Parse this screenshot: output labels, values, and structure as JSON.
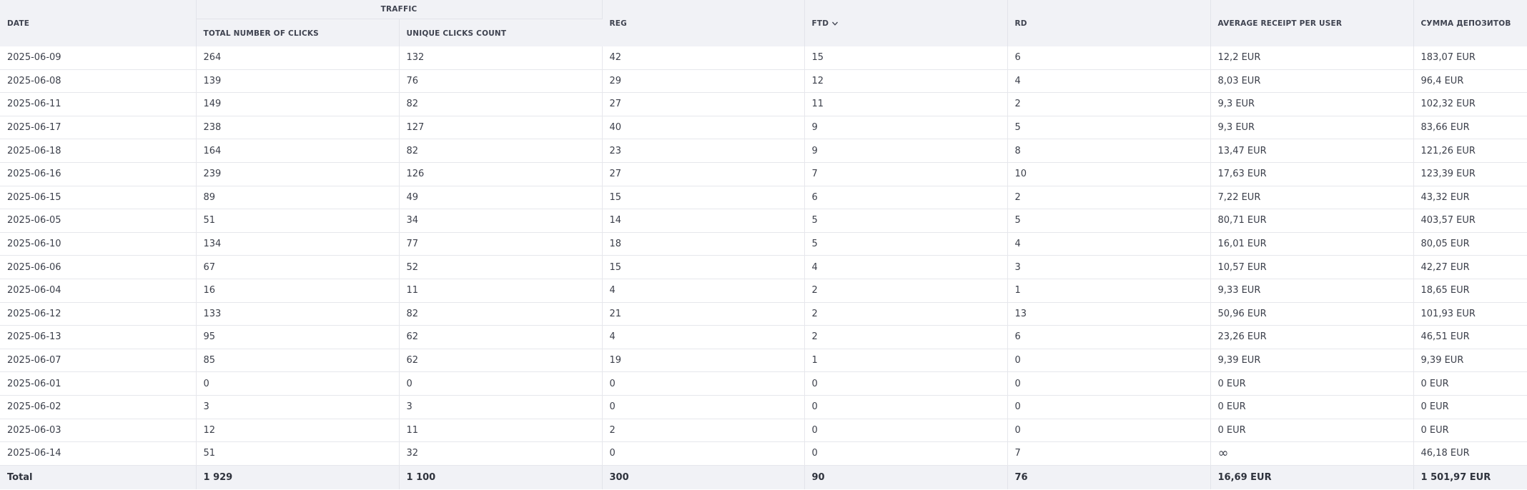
{
  "columns": {
    "date": "DATE",
    "traffic_group": "TRAFFIC",
    "total_clicks": "TOTAL NUMBER OF CLICKS",
    "unique_clicks": "UNIQUE CLICKS COUNT",
    "reg": "REG",
    "ftd": "FTD",
    "rd": "RD",
    "avg_receipt": "AVERAGE RECEIPT PER USER",
    "deposits_sum": "СУММА ДЕПОЗИТОВ"
  },
  "sort": {
    "column": "ftd",
    "direction": "desc",
    "icon": "chevron-down-icon"
  },
  "rows": [
    {
      "date": "2025-06-09",
      "total": "264",
      "unique": "132",
      "reg": "42",
      "ftd": "15",
      "rd": "6",
      "avg": "12,2 EUR",
      "sum": "183,07 EUR"
    },
    {
      "date": "2025-06-08",
      "total": "139",
      "unique": "76",
      "reg": "29",
      "ftd": "12",
      "rd": "4",
      "avg": "8,03 EUR",
      "sum": "96,4 EUR"
    },
    {
      "date": "2025-06-11",
      "total": "149",
      "unique": "82",
      "reg": "27",
      "ftd": "11",
      "rd": "2",
      "avg": "9,3 EUR",
      "sum": "102,32 EUR"
    },
    {
      "date": "2025-06-17",
      "total": "238",
      "unique": "127",
      "reg": "40",
      "ftd": "9",
      "rd": "5",
      "avg": "9,3 EUR",
      "sum": "83,66 EUR"
    },
    {
      "date": "2025-06-18",
      "total": "164",
      "unique": "82",
      "reg": "23",
      "ftd": "9",
      "rd": "8",
      "avg": "13,47 EUR",
      "sum": "121,26 EUR"
    },
    {
      "date": "2025-06-16",
      "total": "239",
      "unique": "126",
      "reg": "27",
      "ftd": "7",
      "rd": "10",
      "avg": "17,63 EUR",
      "sum": "123,39 EUR"
    },
    {
      "date": "2025-06-15",
      "total": "89",
      "unique": "49",
      "reg": "15",
      "ftd": "6",
      "rd": "2",
      "avg": "7,22 EUR",
      "sum": "43,32 EUR"
    },
    {
      "date": "2025-06-05",
      "total": "51",
      "unique": "34",
      "reg": "14",
      "ftd": "5",
      "rd": "5",
      "avg": "80,71 EUR",
      "sum": "403,57 EUR"
    },
    {
      "date": "2025-06-10",
      "total": "134",
      "unique": "77",
      "reg": "18",
      "ftd": "5",
      "rd": "4",
      "avg": "16,01 EUR",
      "sum": "80,05 EUR"
    },
    {
      "date": "2025-06-06",
      "total": "67",
      "unique": "52",
      "reg": "15",
      "ftd": "4",
      "rd": "3",
      "avg": "10,57 EUR",
      "sum": "42,27 EUR"
    },
    {
      "date": "2025-06-04",
      "total": "16",
      "unique": "11",
      "reg": "4",
      "ftd": "2",
      "rd": "1",
      "avg": "9,33 EUR",
      "sum": "18,65 EUR"
    },
    {
      "date": "2025-06-12",
      "total": "133",
      "unique": "82",
      "reg": "21",
      "ftd": "2",
      "rd": "13",
      "avg": "50,96 EUR",
      "sum": "101,93 EUR"
    },
    {
      "date": "2025-06-13",
      "total": "95",
      "unique": "62",
      "reg": "4",
      "ftd": "2",
      "rd": "6",
      "avg": "23,26 EUR",
      "sum": "46,51 EUR"
    },
    {
      "date": "2025-06-07",
      "total": "85",
      "unique": "62",
      "reg": "19",
      "ftd": "1",
      "rd": "0",
      "avg": "9,39 EUR",
      "sum": "9,39 EUR"
    },
    {
      "date": "2025-06-01",
      "total": "0",
      "unique": "0",
      "reg": "0",
      "ftd": "0",
      "rd": "0",
      "avg": "0 EUR",
      "sum": "0 EUR"
    },
    {
      "date": "2025-06-02",
      "total": "3",
      "unique": "3",
      "reg": "0",
      "ftd": "0",
      "rd": "0",
      "avg": "0 EUR",
      "sum": "0 EUR"
    },
    {
      "date": "2025-06-03",
      "total": "12",
      "unique": "11",
      "reg": "2",
      "ftd": "0",
      "rd": "0",
      "avg": "0 EUR",
      "sum": "0 EUR"
    },
    {
      "date": "2025-06-14",
      "total": "51",
      "unique": "32",
      "reg": "0",
      "ftd": "0",
      "rd": "7",
      "avg": "∞",
      "sum": "46,18 EUR"
    }
  ],
  "totals": {
    "label": "Total",
    "total": "1 929",
    "unique": "1 100",
    "reg": "300",
    "ftd": "90",
    "rd": "76",
    "avg": "16,69 EUR",
    "sum": "1 501,97 EUR"
  }
}
